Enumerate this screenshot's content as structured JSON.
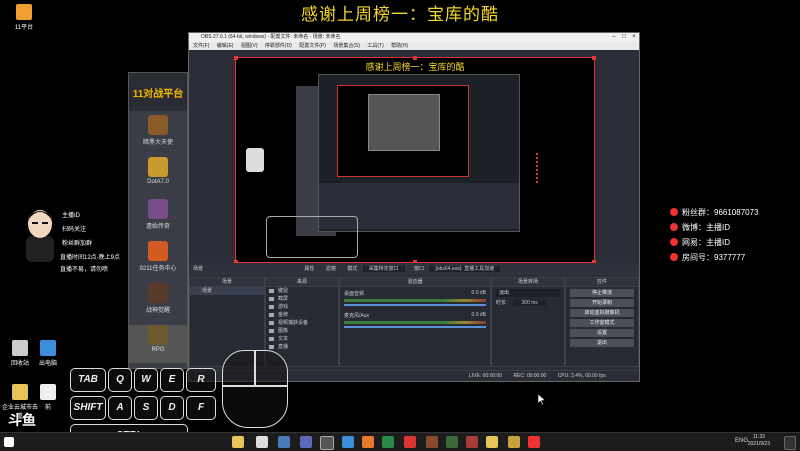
{
  "banner": "感谢上周榜一：宝库的酷",
  "desktop": {
    "top_icon": "11平台",
    "bottom_icons": [
      "回收站",
      "出电脑",
      "企业云城市去重",
      "前"
    ]
  },
  "platform": {
    "logo": "11对战平台",
    "games": [
      "暗黑大天使",
      "DotA7.0",
      "遗始传奇",
      "9211任务中心",
      "战神觉醒",
      "RPG"
    ]
  },
  "obs": {
    "title": "OBS 27.0.1 (64-bit, windows) - 配置文件: 未命名 - 场景: 未命名",
    "menu": [
      "文件(F)",
      "编辑(E)",
      "视图(V)",
      "停靠部件(D)",
      "配置文件(P)",
      "场景集合(S)",
      "工具(T)",
      "帮助(H)"
    ],
    "preview_title": "感谢上周榜一：宝库的酷",
    "scenebar": {
      "label": "场景",
      "props": "属性",
      "filters": "滤镜",
      "mode_label": "模式",
      "mode_value": "采集特定窗口",
      "window_label": "窗口",
      "window_value": "[obs64.exe]: 直播工具加速"
    },
    "docks": {
      "scenes": {
        "header": "场景",
        "items": [
          "场景"
        ]
      },
      "sources": {
        "header": "来源",
        "items": [
          "键鼠",
          "截屏",
          "游戏",
          "金牌",
          "视频捕获设备",
          "图像",
          "文本",
          "直播"
        ]
      },
      "mixer": {
        "header": "混音器",
        "tracks": [
          {
            "name": "桌面音频",
            "level": "0.0 dB"
          },
          {
            "name": "麦克风/Aux",
            "level": "0.0 dB"
          }
        ]
      },
      "transitions": {
        "header": "场景转场",
        "type": "淡出",
        "duration_label": "时长",
        "duration": "300 ms"
      },
      "controls": {
        "header": "控件",
        "buttons": [
          "停止推流",
          "开始录制",
          "启动虚拟摄像机",
          "工作室模式",
          "设置",
          "退出"
        ]
      }
    },
    "status": {
      "live": "LIVE: 00:00:00",
      "rec": "REC: 00:00:00",
      "cpu": "CPU: 3.4%, 60.00 fps"
    }
  },
  "streamer": {
    "fans": "粉丝群：9661087073",
    "weibo": "微博：主播ID",
    "netease": "网易：主播ID",
    "room": "房间号：9377777"
  },
  "left_notes": [
    "主播ID",
    "扫码关注",
    "粉丝群加群",
    "直播时间12点-晚上9点",
    "直播不易，请勿喷"
  ],
  "keys": {
    "row1": [
      "TAB",
      "Q",
      "W",
      "E",
      "R"
    ],
    "row2": [
      "SHIFT",
      "A",
      "S",
      "D",
      "F"
    ],
    "row3": [
      "CTRL"
    ],
    "brand": "斗鱼"
  },
  "taskbar": {
    "lang": "ENG",
    "time": "11:33",
    "date": "2021/9/23"
  }
}
